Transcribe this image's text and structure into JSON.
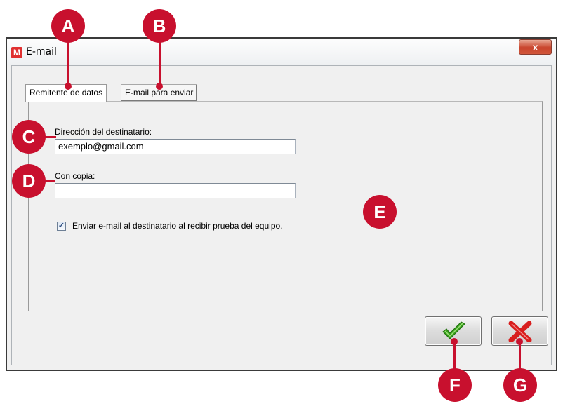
{
  "window": {
    "title": "E-mail",
    "app_icon_letter": "M",
    "close_symbol": "x"
  },
  "tabs": [
    {
      "label": "Remitente de datos",
      "active": true
    },
    {
      "label": "E-mail para enviar",
      "active": false
    }
  ],
  "form": {
    "recipient_label": "Dirección del destinatario:",
    "recipient_value": "exemplo@gmail.com",
    "cc_label": "Con copia:",
    "cc_value": "",
    "checkbox_checked": true,
    "checkbox_mark": "✓",
    "checkbox_label": "Enviar e-mail al destinatario al recibir prueba del equipo."
  },
  "buttons": {
    "ok_icon": "green-check-icon",
    "cancel_icon": "red-x-icon"
  },
  "callouts": [
    "A",
    "B",
    "C",
    "D",
    "E",
    "F",
    "G"
  ],
  "colors": {
    "callout": "#c8102e",
    "ok_check": "#3aa31e",
    "cancel_x": "#d81e1e",
    "close_button": "#c8442c"
  }
}
